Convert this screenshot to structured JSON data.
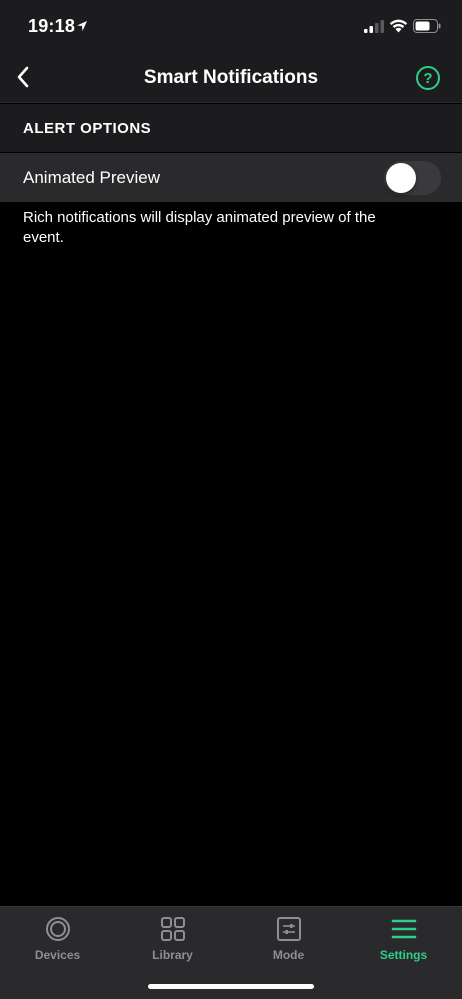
{
  "status_bar": {
    "time": "19:18",
    "icons": [
      "location-arrow-icon",
      "signal-icon",
      "wifi-icon",
      "battery-icon"
    ]
  },
  "nav": {
    "title": "Smart Notifications",
    "back_icon": "chevron-left-icon",
    "help_icon": "question-circle-icon",
    "help_symbol": "?"
  },
  "alert_options": {
    "header": "ALERT OPTIONS",
    "animated_preview": {
      "label": "Animated Preview",
      "enabled": false
    },
    "description": "Rich notifications will display animated preview of the event."
  },
  "tab_bar": {
    "items": [
      {
        "label": "Devices",
        "icon": "devices-icon",
        "active": false
      },
      {
        "label": "Library",
        "icon": "library-grid-icon",
        "active": false
      },
      {
        "label": "Mode",
        "icon": "mode-sliders-icon",
        "active": false
      },
      {
        "label": "Settings",
        "icon": "hamburger-menu-icon",
        "active": true
      }
    ]
  },
  "colors": {
    "accent": "#2dce89",
    "background": "#000000",
    "panel": "#1c1c1e",
    "row": "#2a2a2c",
    "inactive_tab": "#8e8e93"
  }
}
